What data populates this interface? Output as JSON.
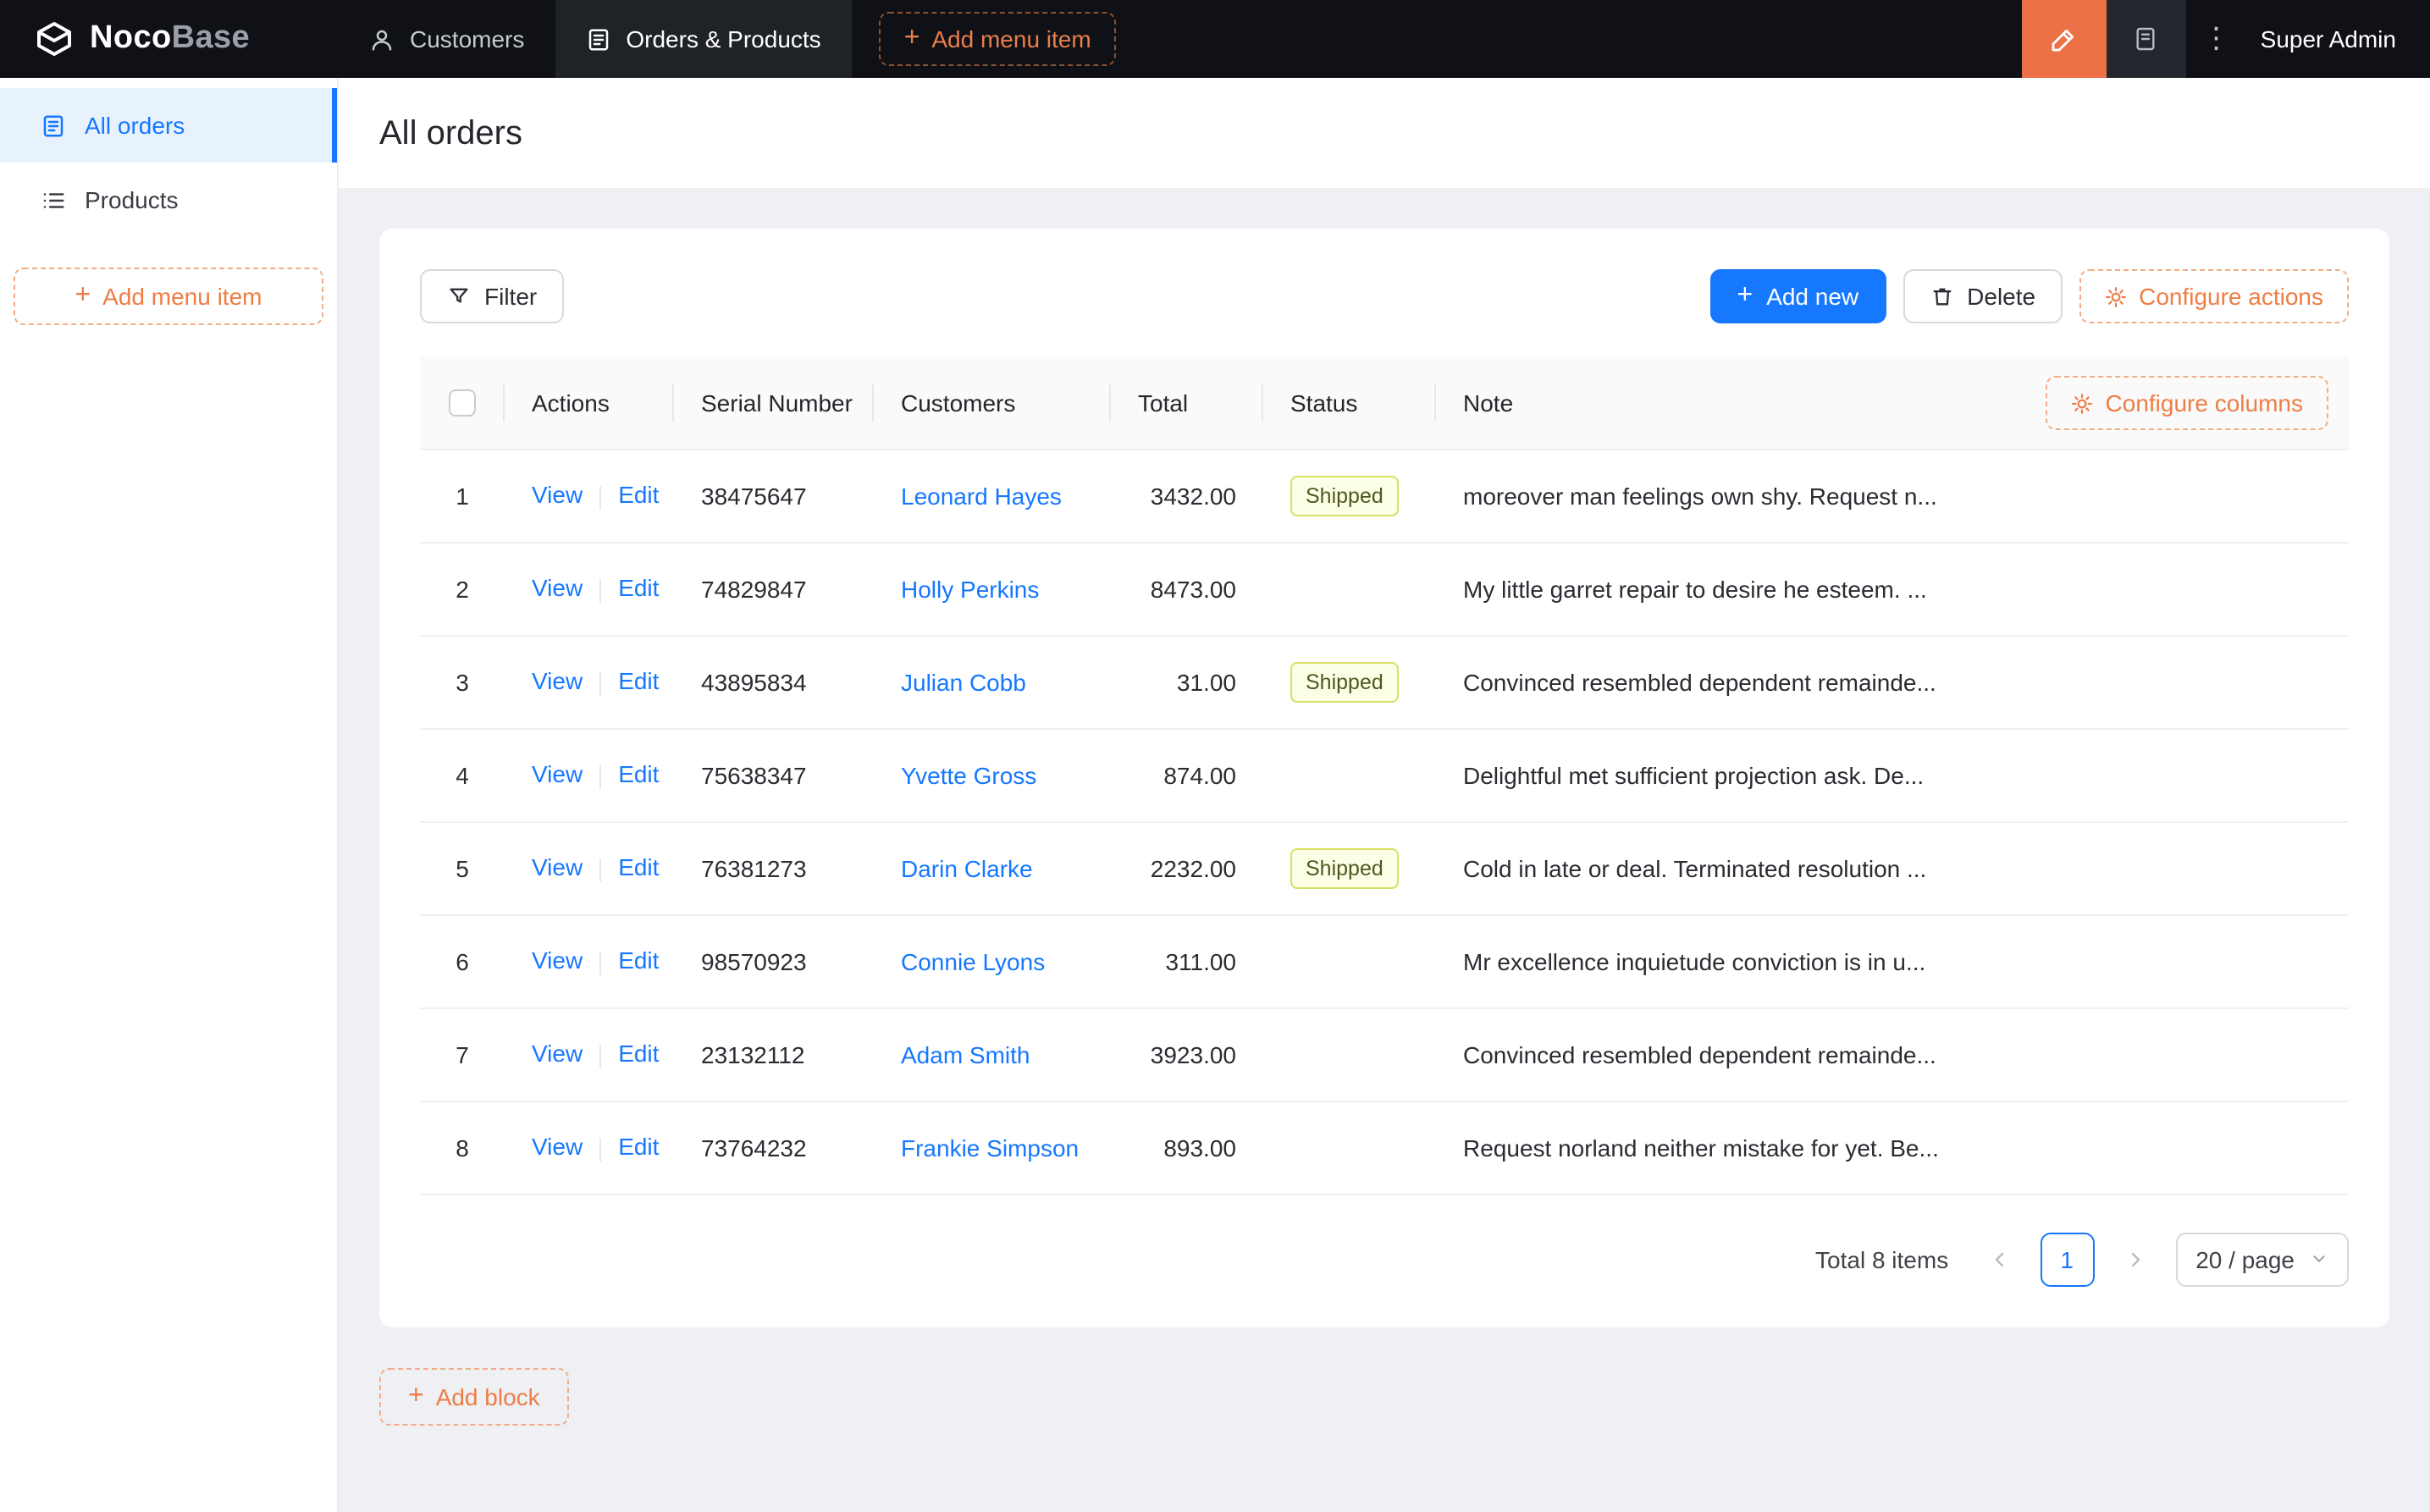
{
  "navbar": {
    "logo_primary": "Noco",
    "logo_secondary": "Base",
    "items": [
      {
        "label": "Customers",
        "active": false
      },
      {
        "label": "Orders & Products",
        "active": true
      }
    ],
    "add_menu_item_label": "Add menu item",
    "user": "Super Admin"
  },
  "sidebar": {
    "items": [
      {
        "label": "All orders",
        "active": true
      },
      {
        "label": "Products",
        "active": false
      }
    ],
    "add_menu_item_label": "Add menu item"
  },
  "page": {
    "title": "All orders",
    "add_block_label": "Add block"
  },
  "toolbar": {
    "filter_label": "Filter",
    "add_new_label": "Add new",
    "delete_label": "Delete",
    "configure_actions_label": "Configure actions"
  },
  "table": {
    "configure_columns_label": "Configure columns",
    "columns": {
      "actions": "Actions",
      "serial": "Serial Number",
      "customers": "Customers",
      "total": "Total",
      "status": "Status",
      "note": "Note"
    },
    "action_labels": {
      "view": "View",
      "edit": "Edit"
    },
    "rows": [
      {
        "index": "1",
        "serial": "38475647",
        "customer": "Leonard Hayes",
        "total": "3432.00",
        "status": "Shipped",
        "note": "moreover man feelings own shy. Request n..."
      },
      {
        "index": "2",
        "serial": "74829847",
        "customer": "Holly Perkins",
        "total": "8473.00",
        "status": "",
        "note": "My little garret repair to desire he esteem. ..."
      },
      {
        "index": "3",
        "serial": "43895834",
        "customer": "Julian Cobb",
        "total": "31.00",
        "status": "Shipped",
        "note": "Convinced resembled dependent remainde..."
      },
      {
        "index": "4",
        "serial": "75638347",
        "customer": "Yvette Gross",
        "total": "874.00",
        "status": "",
        "note": "Delightful met sufficient projection ask. De..."
      },
      {
        "index": "5",
        "serial": "76381273",
        "customer": "Darin Clarke",
        "total": "2232.00",
        "status": "Shipped",
        "note": "Cold in late or deal. Terminated resolution ..."
      },
      {
        "index": "6",
        "serial": "98570923",
        "customer": "Connie Lyons",
        "total": "311.00",
        "status": "",
        "note": "Mr excellence inquietude conviction is in u..."
      },
      {
        "index": "7",
        "serial": "23132112",
        "customer": "Adam Smith",
        "total": "3923.00",
        "status": "",
        "note": "Convinced resembled dependent remainde..."
      },
      {
        "index": "8",
        "serial": "73764232",
        "customer": "Frankie Simpson",
        "total": "893.00",
        "status": "",
        "note": "Request norland neither mistake for yet. Be..."
      }
    ],
    "pagination": {
      "total_text": "Total 8 items",
      "current_page": "1",
      "page_size": "20 / page"
    }
  },
  "icons": {
    "plus": "+",
    "more_menu": "⋮"
  },
  "colors": {
    "primary_blue": "#1677ff",
    "accent_orange": "#ed7d45",
    "designer_button_bg": "#ec7146",
    "navbar_bg": "#0f1116",
    "navbar_active_bg": "#1f2227",
    "sidebar_active_bg": "#e7f2fd",
    "badge_bg": "#fcffe6",
    "badge_border": "#d7e063",
    "page_bg": "#eff0f3"
  }
}
